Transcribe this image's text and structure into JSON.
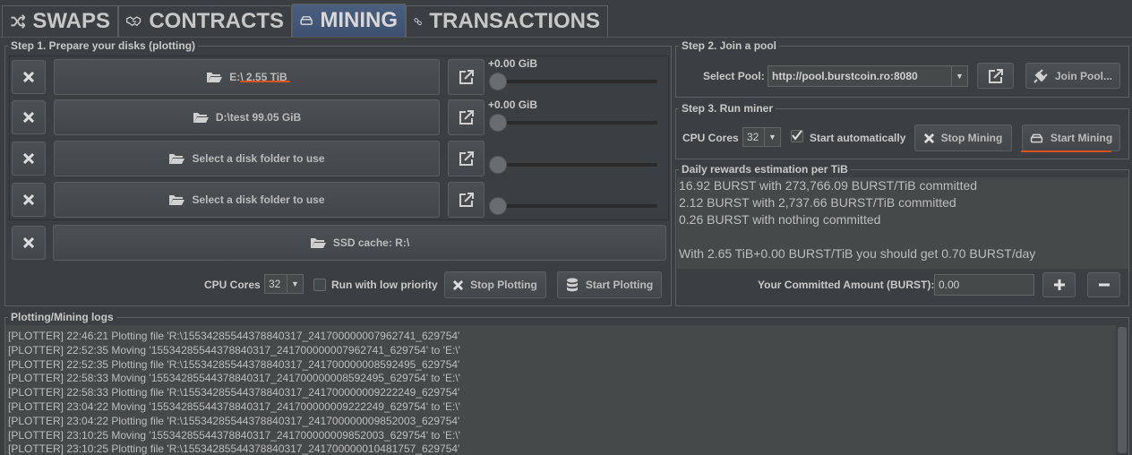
{
  "tabs": [
    {
      "label": "SWAPS",
      "icon": "shuffle-icon"
    },
    {
      "label": "CONTRACTS",
      "icon": "handshake-icon"
    },
    {
      "label": "MINING",
      "icon": "hard-drive-icon"
    },
    {
      "label": "TRANSACTIONS",
      "icon": "link-icon"
    }
  ],
  "step1": {
    "title": "Step 1. Prepare your disks (plotting)",
    "disks": [
      {
        "label": "E:\\ 2.55 TiB",
        "slider_value": "+0.00 GiB",
        "slider_level": 0
      },
      {
        "label": "D:\\test 99.05 GiB",
        "slider_value": "+0.00 GiB",
        "slider_level": 0
      },
      {
        "label": "Select a disk folder to use",
        "slider_value": "",
        "slider_level": 0
      },
      {
        "label": "Select a disk folder to use",
        "slider_value": "",
        "slider_level": 0
      }
    ],
    "ssd_cache": "SSD cache: R:\\",
    "cpu_cores_label": "CPU Cores",
    "cpu_cores_value": "32",
    "low_priority_label": "Run with low priority",
    "low_priority_checked": false,
    "stop_plotting": "Stop Plotting",
    "start_plotting": "Start Plotting"
  },
  "step2": {
    "title": "Step 2. Join a pool",
    "select_pool_label": "Select Pool:",
    "pool_value": "http://pool.burstcoin.ro:8080",
    "join_pool": "Join Pool..."
  },
  "step3": {
    "title": "Step 3. Run miner",
    "cpu_cores_label": "CPU Cores",
    "cpu_cores_value": "32",
    "start_auto_label": "Start automatically",
    "start_auto_checked": true,
    "stop_mining": "Stop Mining",
    "start_mining": "Start Mining"
  },
  "rewards": {
    "title": "Daily rewards estimation per TiB",
    "lines": [
      "16.92 BURST with 273,766.09 BURST/TiB committed",
      "2.12 BURST with 2,737.66 BURST/TiB committed",
      "0.26 BURST with nothing committed",
      "",
      "With 2.65 TiB+0.00 BURST/TiB you should get 0.70 BURST/day"
    ],
    "committed_label": "Your Committed Amount (BURST):",
    "committed_value": "0.00"
  },
  "logs": {
    "title": "Plotting/Mining logs",
    "lines": [
      "[PLOTTER] 22:46:21 Plotting file 'R:\\15534285544378840317_241700000007962741_629754'",
      "[PLOTTER] 22:52:35 Moving '15534285544378840317_241700000007962741_629754' to 'E:\\'",
      "[PLOTTER] 22:52:35 Plotting file 'R:\\15534285544378840317_241700000008592495_629754'",
      "[PLOTTER] 22:58:33 Moving '15534285544378840317_241700000008592495_629754' to 'E:\\'",
      "[PLOTTER] 22:58:33 Plotting file 'R:\\15534285544378840317_241700000009222249_629754'",
      "[PLOTTER] 23:04:22 Moving '15534285544378840317_241700000009222249_629754' to 'E:\\'",
      "[PLOTTER] 23:04:22 Plotting file 'R:\\15534285544378840317_241700000009852003_629754'",
      "[PLOTTER] 23:10:25 Moving '15534285544378840317_241700000009852003_629754' to 'E:\\'",
      "[PLOTTER] 23:10:25 Plotting file 'R:\\15534285544378840317_241700000010481757_629754'"
    ]
  },
  "colors": {
    "accent": "#4b6eaf",
    "annotation": "#d9531e",
    "background": "#3c3f41"
  }
}
